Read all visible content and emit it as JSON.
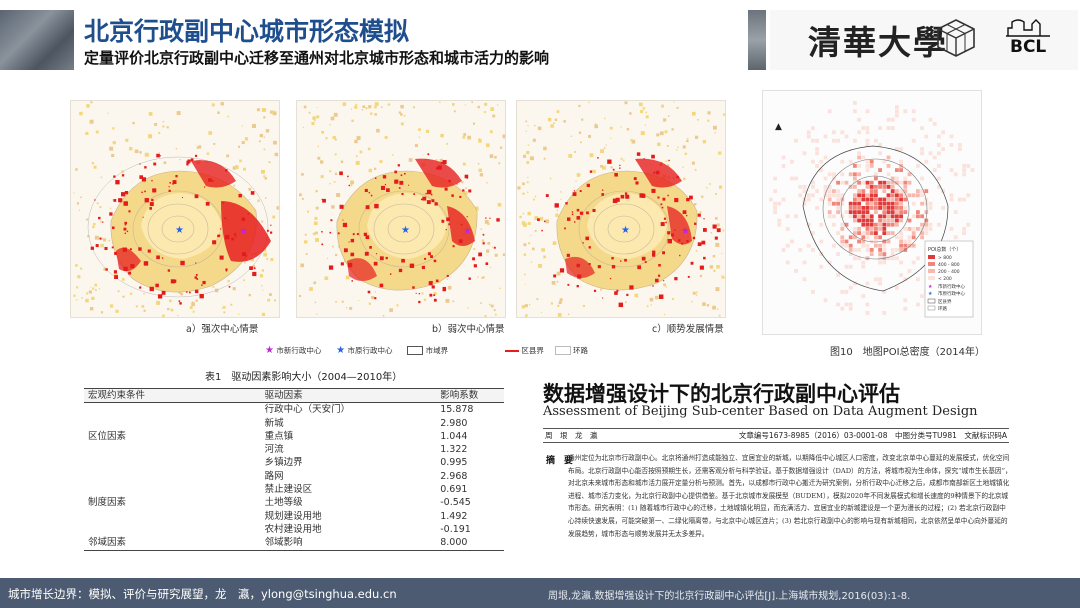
{
  "header": {
    "title": "北京行政副中心城市形态模拟",
    "subtitle": "定量评价北京行政副中心迁移至通州对北京城市形态和城市活力的影响",
    "logo_text": "清華大學",
    "lab_logo": "BCL"
  },
  "maps": [
    {
      "caption": "a）强次中心情景"
    },
    {
      "caption": "b）弱次中心情景"
    },
    {
      "caption": "c）顺势发展情景"
    }
  ],
  "map_legend": {
    "new_center": "市新行政中心",
    "admin_center": "市原行政中心",
    "city_boundary": "市域界",
    "district": "区县界",
    "ring": "环路"
  },
  "poi_map": {
    "caption": "图10　地图POI总密度（2014年）",
    "legend_title": "POI总数（个）",
    "legend_items": [
      "> 800",
      "400 - 800",
      "200 - 400",
      "< 200"
    ],
    "legend_extra": [
      "市新行政中心",
      "市原行政中心",
      "区县界",
      "环路"
    ],
    "colors": [
      "#e03a3a",
      "#f0857a",
      "#f7b8ad",
      "#fbe2dc"
    ]
  },
  "table": {
    "title": "表1　驱动因素影响大小（2004—2010年）",
    "headers": [
      "宏观约束条件",
      "驱动因素",
      "影响系数"
    ],
    "groups": [
      {
        "name": "区位因素",
        "rows": [
          {
            "factor": "行政中心（天安门）",
            "value": "15.878"
          },
          {
            "factor": "新城",
            "value": "2.980"
          },
          {
            "factor": "重点镇",
            "value": "1.044"
          },
          {
            "factor": "河流",
            "value": "1.322"
          },
          {
            "factor": "乡镇边界",
            "value": "0.995"
          },
          {
            "factor": "路网",
            "value": "2.968"
          }
        ]
      },
      {
        "name": "制度因素",
        "rows": [
          {
            "factor": "禁止建设区",
            "value": "0.691"
          },
          {
            "factor": "土地等级",
            "value": "-0.545"
          },
          {
            "factor": "规划建设用地",
            "value": "1.492"
          },
          {
            "factor": "农村建设用地",
            "value": "-0.191"
          }
        ]
      },
      {
        "name": "邻域因素",
        "rows": [
          {
            "factor": "邻域影响",
            "value": "8.000"
          }
        ]
      }
    ]
  },
  "paper": {
    "title": "数据增强设计下的北京行政副中心评估",
    "subtitle": "Assessment of Beijing Sub-center Based on Data Augment Design",
    "authors": "周　垠　龙　瀛",
    "codes": "文章编号1673-8985（2016）03-0001-08　中图分类号TU981　文献标识码A",
    "abstract_label": "摘　要",
    "abstract": "通州定位为北京市行政副中心。北京将通州打造成能独立、宜居宜业的新城，以期降低中心城区人口密度，改变北京单中心蔓延的发展模式，优化空间布局。北京行政副中心能否按照预期生长，还需客观分析与科学验证。基于数据增强设计（DAD）的方法，将城市视为生命体，探究“城市生长基因”，对北京未来城市形态和城市活力展开定量分析与预测。首先，以成都市行政中心搬迁为研究案例，分析行政中心迁移之后，成都市南部新区土地城镇化进程、城市活力变化，为北京行政副中心提供借鉴。基于北京城市发展模型（BUDEM），模拟2020年不同发展模式和增长速度的9种情景下的北京城市形态。研究表明：(1) 随着城市行政中心的迁移，土地城镇化明显，而充满活力、宜居宜业的新城建设是一个更为漫长的过程；(2) 若北京行政副中心持续快速发展，可能突破第一、二绿化隔离带，与北京中心城区连片；(3) 若北京行政副中心的影响与现有新城相同，北京依然呈单中心向外蔓延的发展趋势，城市形态与顺势发展并无太多差异。"
  },
  "footer": {
    "left": "城市增长边界：模拟、评价与研究展望，龙　瀛，ylong@tsinghua.edu.cn",
    "right": "周垠,龙瀛.数据增强设计下的北京行政副中心评估[J].上海城市规划,2016(03):1-8."
  }
}
